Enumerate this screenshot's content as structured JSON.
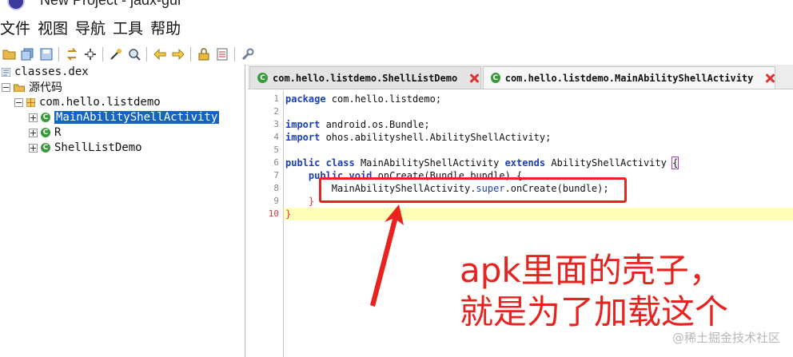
{
  "window": {
    "title": "New Project - jadx-gui"
  },
  "menu": [
    "文件",
    "视图",
    "导航",
    "工具",
    "帮助"
  ],
  "toolbar": {
    "icons": [
      "open-folder-icon",
      "save-all-icon",
      "save-icon",
      "sync-icon",
      "expand-icon",
      "wand-icon",
      "search-icon",
      "back-arrow-icon",
      "forward-arrow-icon",
      "lock-icon",
      "log-icon",
      "wrench-icon"
    ]
  },
  "tree": {
    "root": "classes.dex",
    "source": "源代码",
    "package": "com.hello.listdemo",
    "classes": [
      "MainAbilityShellActivity",
      "R",
      "ShellListDemo"
    ],
    "class_badge": "C"
  },
  "tabs": [
    {
      "label": "com.hello.listdemo.ShellListDemo"
    },
    {
      "label": "com.hello.listdemo.MainAbilityShellActivity"
    }
  ],
  "code": {
    "line_numbers": [
      "1",
      "2",
      "3",
      "4",
      "5",
      "6",
      "7",
      "8",
      "9",
      "10"
    ],
    "l1_kw": "package",
    "l1_rest": " com.hello.listdemo;",
    "l3_kw": "import",
    "l3_rest": " android.os.Bundle;",
    "l4_kw": "import",
    "l4_rest": " ohos.abilityshell.AbilityShellActivity;",
    "l6_kw1": "public",
    "l6_kw2": "class",
    "l6_name": " MainAbilityShellActivity ",
    "l6_kw3": "extends",
    "l6_rest": " AbilityShellActivity ",
    "l6_brace": "{",
    "l7_indent": "    ",
    "l7_kw1": "public",
    "l7_kw2": "void",
    "l7_rest": " onCreate(Bundle bundle) {",
    "l8_indent": "        ",
    "l8_a": "MainAbilityShellActivity.",
    "l8_kw": "super",
    "l8_b": ".onCreate(bundle);",
    "l9_indent": "    ",
    "l9_brace": "}",
    "l10_brace": "}"
  },
  "annotation": {
    "line1": "apk里面的壳子，",
    "line2": "就是为了加载这个",
    "color": "#e8231f"
  },
  "watermark": "@稀土掘金技术社区"
}
